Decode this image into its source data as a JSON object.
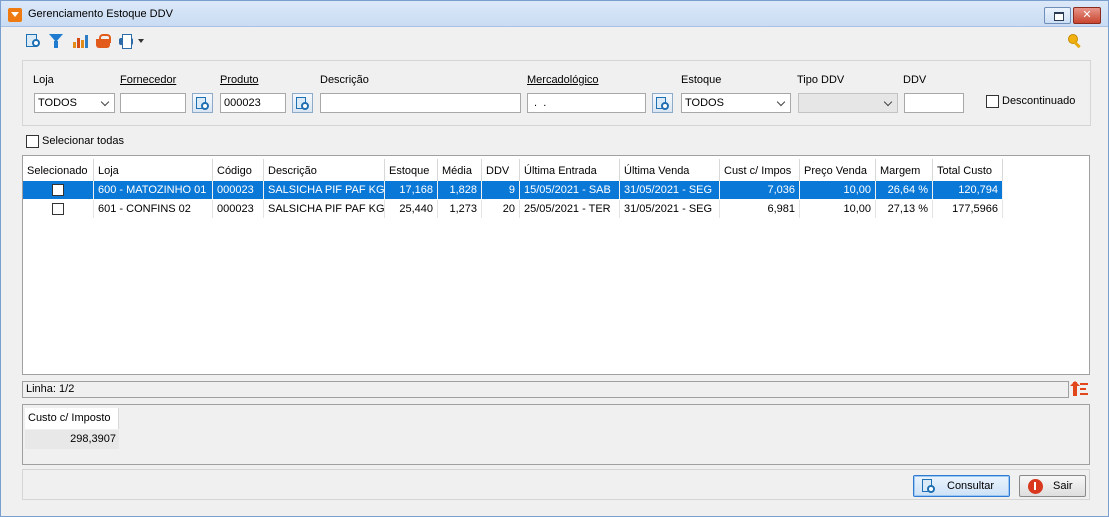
{
  "window": {
    "title": "Gerenciamento Estoque DDV"
  },
  "toolbar": {
    "icons": [
      "search-document-icon",
      "filter-icon",
      "chart-icon",
      "basket-icon",
      "print-icon",
      "dropdown-arrow-icon",
      "key-icon"
    ]
  },
  "filters": {
    "loja": {
      "label": "Loja",
      "value": "TODOS"
    },
    "fornecedor": {
      "label": "Fornecedor",
      "value": ""
    },
    "produto": {
      "label": "Produto",
      "value": "000023"
    },
    "descricao": {
      "label": "Descrição",
      "value": ""
    },
    "mercadologico": {
      "label": "Mercadológico",
      "value": " .  ."
    },
    "estoque": {
      "label": "Estoque",
      "value": "TODOS"
    },
    "tipo_ddv": {
      "label": "Tipo DDV",
      "value": ""
    },
    "ddv": {
      "label": "DDV",
      "value": ""
    },
    "descontinuado": {
      "label": "Descontinuado",
      "checked": false
    }
  },
  "select_all": {
    "label": "Selecionar todas",
    "checked": false
  },
  "grid": {
    "columns": [
      "Selecionado",
      "Loja",
      "Código",
      "Descrição",
      "Estoque",
      "Média",
      "DDV",
      "Última Entrada",
      "Última Venda",
      "Cust c/ Impos",
      "Preço Venda",
      "Margem",
      "Total Custo"
    ],
    "rows": [
      {
        "selected": true,
        "loja": "600 - MATOZINHO 01",
        "codigo": "000023",
        "descricao": "SALSICHA PIF PAF KG",
        "estoque": "17,168",
        "media": "1,828",
        "ddv": "9",
        "ultima_entrada": "15/05/2021 - SAB",
        "ultima_venda": "31/05/2021 - SEG",
        "cust_impos": "7,036",
        "preco_venda": "10,00",
        "margem": "26,64 %",
        "total_custo": "120,794"
      },
      {
        "selected": false,
        "loja": "601 - CONFINS 02",
        "codigo": "000023",
        "descricao": "SALSICHA PIF PAF KG",
        "estoque": "25,440",
        "media": "1,273",
        "ddv": "20",
        "ultima_entrada": "25/05/2021 - TER",
        "ultima_venda": "31/05/2021 - SEG",
        "cust_impos": "6,981",
        "preco_venda": "10,00",
        "margem": "27,13 %",
        "total_custo": "177,5966"
      }
    ]
  },
  "status": {
    "linha": "Linha: 1/2"
  },
  "summary": {
    "label": "Custo c/ Imposto",
    "value": "298,3907"
  },
  "buttons": {
    "consultar": "Consultar",
    "sair": "Sair"
  },
  "colors": {
    "selection": "#0a78d7",
    "accent_orange": "#f07a12",
    "exit_red": "#d9381e"
  }
}
